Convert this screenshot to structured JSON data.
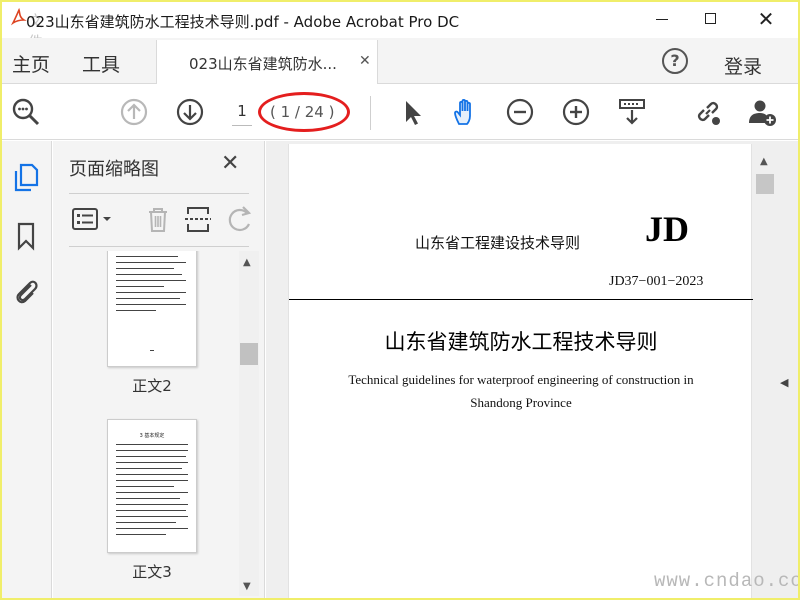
{
  "window": {
    "title": "023山东省建筑防水工程技术导则.pdf - Adobe Acrobat Pro DC",
    "ghost_text": "文件",
    "minimize_icon": "minimize-icon",
    "maximize_icon": "maximize-icon",
    "close_glyph": "✕"
  },
  "tabs": {
    "home": "主页",
    "tools": "工具",
    "document": "023山东省建筑防水...",
    "document_close": "✕",
    "help": "?",
    "login": "登录"
  },
  "toolbar": {
    "icons": [
      "zoom-search-icon",
      "previous-page-icon",
      "next-page-icon",
      "select-cursor-icon",
      "hand-tool-icon",
      "zoom-out-icon",
      "zoom-in-icon",
      "scroll-mode-icon",
      "share-link-icon",
      "add-user-icon"
    ],
    "page_current": "1",
    "page_count": "( 1 / 24 )",
    "highlight_color": "#e41e1e"
  },
  "left_rail": {
    "icons": [
      "page-thumbnails-icon",
      "bookmarks-icon",
      "attachments-icon"
    ],
    "accent_color": "#1473e6"
  },
  "thumbnails": {
    "title": "页面缩略图",
    "close": "✕",
    "tools": [
      "thumbnail-options-icon",
      "delete-page-icon",
      "insert-page-icon",
      "rotate-page-icon"
    ],
    "pages": [
      {
        "label": "正文2"
      },
      {
        "label": "正文3",
        "heading": "3  基本规定"
      }
    ]
  },
  "document": {
    "series": "山东省工程建设技术导则",
    "code": "JD",
    "number": "JD37−001−2023",
    "title_cn": "山东省建筑防水工程技术导则",
    "title_en": "Technical guidelines for waterproof engineering of construction in Shandong Province"
  },
  "watermark": "www.cndao.com"
}
